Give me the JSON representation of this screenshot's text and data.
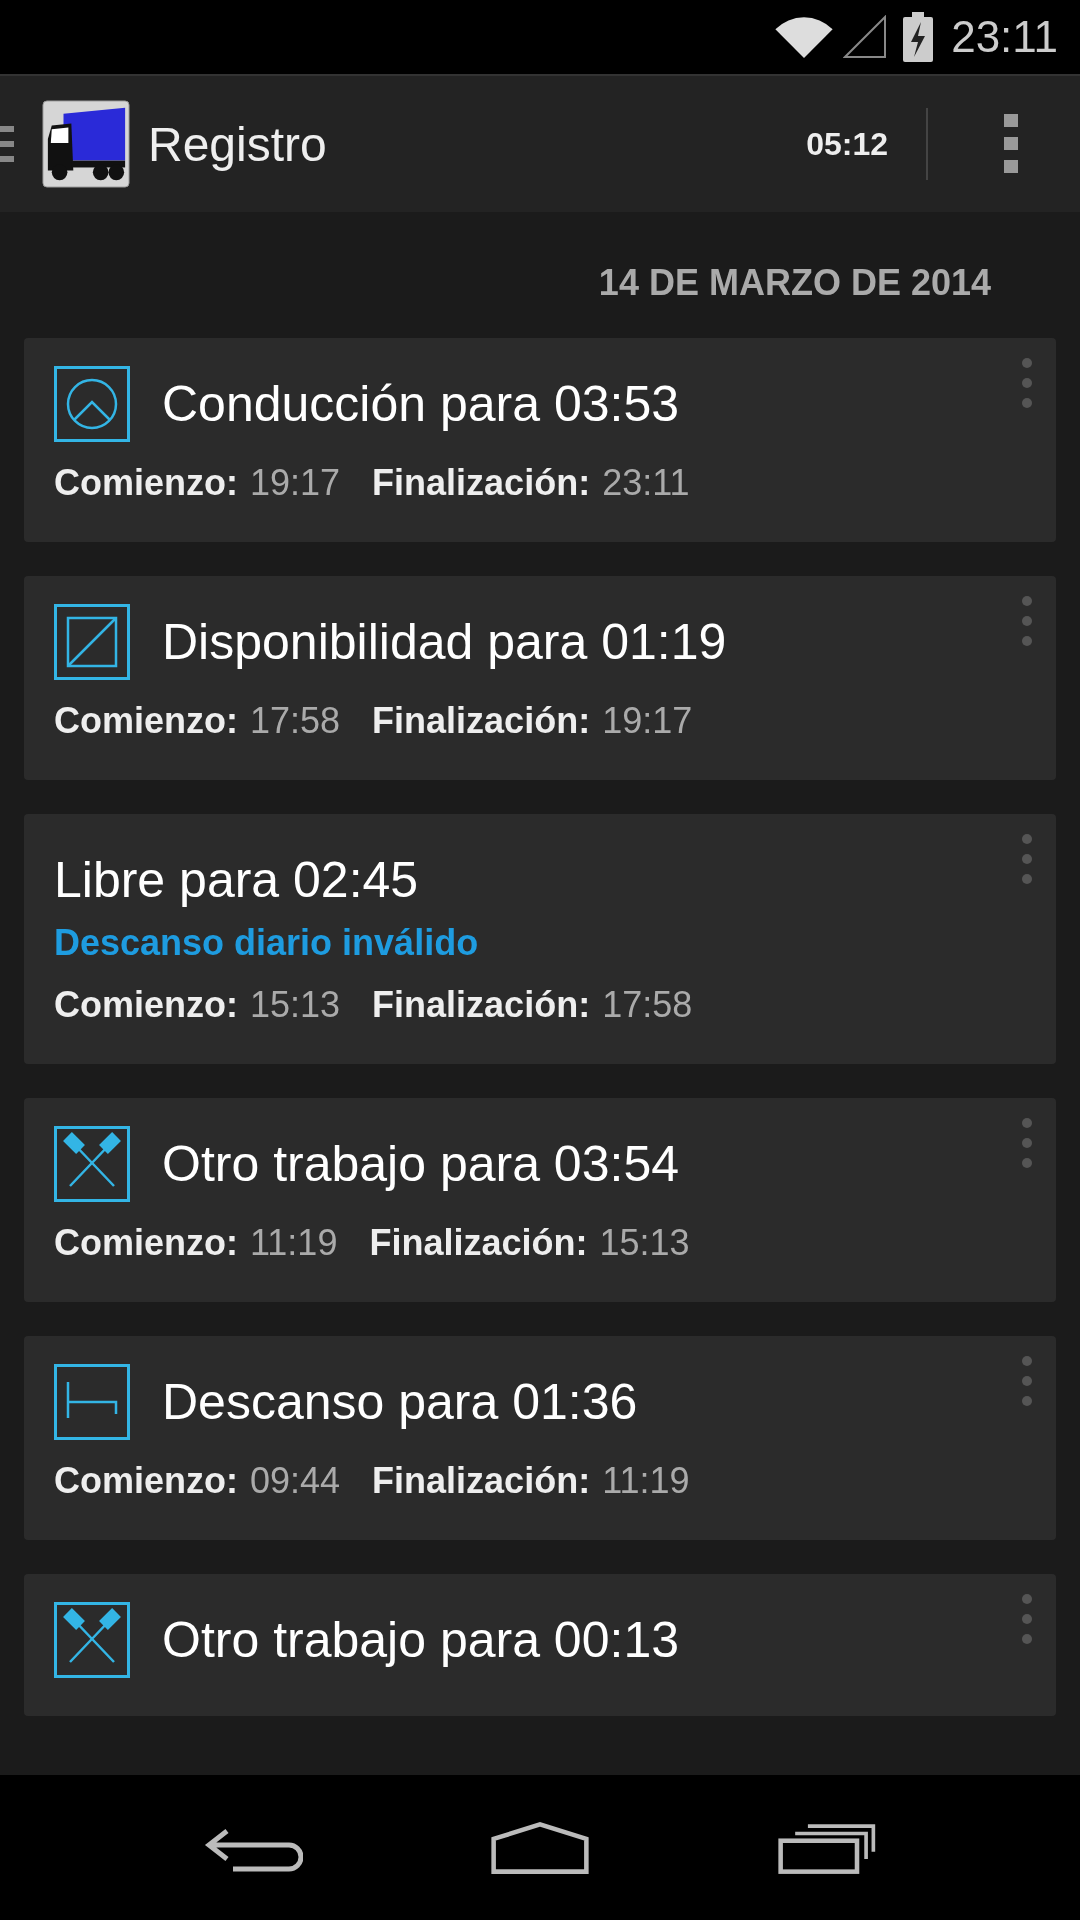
{
  "status_bar": {
    "time": "23:11"
  },
  "action_bar": {
    "title": "Registro",
    "timer": "05:12"
  },
  "date_header": "14 DE MARZO DE 2014",
  "entries": [
    {
      "kind": "driving",
      "title": "Conducción para 03:53",
      "start_label": "Comienzo:",
      "start": "19:17",
      "end_label": "Finalización:",
      "end": "23:11"
    },
    {
      "kind": "availability",
      "title": "Disponibilidad para 01:19",
      "start_label": "Comienzo:",
      "start": "17:58",
      "end_label": "Finalización:",
      "end": "19:17"
    },
    {
      "kind": "free",
      "title": "Libre para 02:45",
      "warning": "Descanso diario inválido",
      "start_label": "Comienzo:",
      "start": "15:13",
      "end_label": "Finalización:",
      "end": "17:58"
    },
    {
      "kind": "other_work",
      "title": "Otro trabajo para 03:54",
      "start_label": "Comienzo:",
      "start": "11:19",
      "end_label": "Finalización:",
      "end": "15:13"
    },
    {
      "kind": "rest",
      "title": "Descanso para 01:36",
      "start_label": "Comienzo:",
      "start": "09:44",
      "end_label": "Finalización:",
      "end": "11:19"
    },
    {
      "kind": "other_work",
      "title": "Otro trabajo para 00:13"
    }
  ]
}
